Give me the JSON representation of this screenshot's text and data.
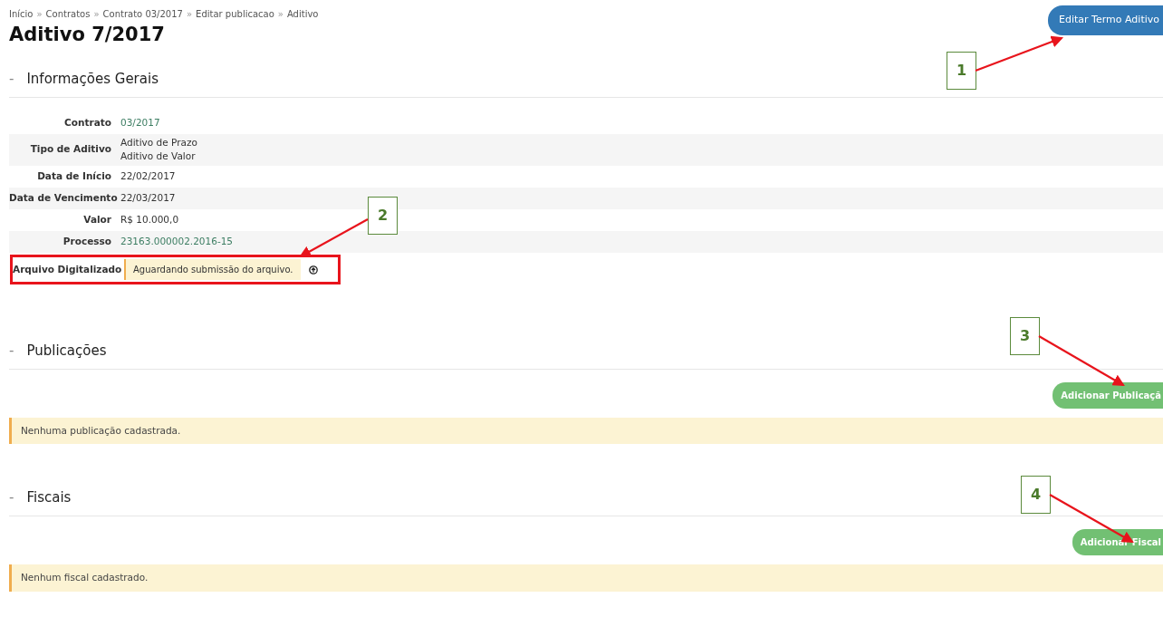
{
  "breadcrumb": [
    {
      "label": "Início"
    },
    {
      "separator": "»",
      "label": "Contratos"
    },
    {
      "separator": "»",
      "label": "Contrato 03/2017"
    },
    {
      "separator": "»",
      "label": "Editar publicacao"
    },
    {
      "separator": "»",
      "label": "Aditivo"
    }
  ],
  "title": "Aditivo 7/2017",
  "edit_button": "Editar Termo Aditivo",
  "info": {
    "marker": "-",
    "heading": "Informações Gerais",
    "rows": [
      {
        "label": "Contrato",
        "kind": "link",
        "values": [
          "03/2017"
        ]
      },
      {
        "label": "Tipo de Aditivo",
        "kind": "text",
        "values": [
          "Aditivo de Prazo",
          "Aditivo de Valor"
        ]
      },
      {
        "label": "Data de Início",
        "kind": "text",
        "values": [
          "22/02/2017"
        ]
      },
      {
        "label": "Data de Vencimento",
        "kind": "text",
        "values": [
          "22/03/2017"
        ]
      },
      {
        "label": "Valor",
        "kind": "text",
        "values": [
          "R$ 10.000,0"
        ]
      },
      {
        "label": "Processo",
        "kind": "link",
        "values": [
          "23163.000002.2016-15"
        ]
      },
      {
        "label": "Arquivo Digitalizado",
        "kind": "status",
        "highlighted": true,
        "values": [
          "Aguardando submissão do arquivo."
        ]
      }
    ]
  },
  "sections": [
    {
      "marker": "-",
      "heading": "Publicações",
      "button": "Adicionar Publicaçã",
      "empty_message": "Nenhuma publicação cadastrada."
    },
    {
      "marker": "-",
      "heading": "Fiscais",
      "button": "Adicionar Fiscal",
      "empty_message": "Nenhum fiscal cadastrado."
    }
  ],
  "annotations": [
    {
      "label": "1"
    },
    {
      "label": "2"
    },
    {
      "label": "3"
    },
    {
      "label": "4"
    }
  ]
}
